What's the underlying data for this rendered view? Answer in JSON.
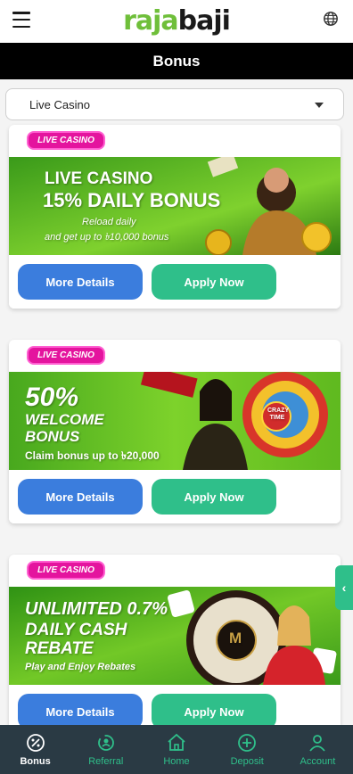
{
  "header": {
    "logo_part1": "raja",
    "logo_part2": "baji"
  },
  "titlebar": {
    "title": "Bonus"
  },
  "filter": {
    "selected": "Live Casino"
  },
  "cards": [
    {
      "tag": "LIVE CASINO",
      "line1": "LIVE CASINO",
      "line2": "15% DAILY BONUS",
      "line3": "Reload daily",
      "line4": "and get up to ৳10,000 bonus",
      "more_label": "More Details",
      "apply_label": "Apply Now"
    },
    {
      "tag": "LIVE CASINO",
      "line1": "50%",
      "line2": "WELCOME",
      "line3": "BONUS",
      "line4": "Claim bonus up to ৳20,000",
      "wheel_label": "CRAZY TIME",
      "more_label": "More Details",
      "apply_label": "Apply Now"
    },
    {
      "tag": "LIVE CASINO",
      "line1": "UNLIMITED 0.7%",
      "line2": "DAILY CASH",
      "line3": "REBATE",
      "line4": "Play and Enjoy Rebates",
      "wheel_label": "M",
      "more_label": "More Details",
      "apply_label": "Apply Now"
    }
  ],
  "nav": [
    {
      "label": "Bonus",
      "icon": "bonus-percent-icon"
    },
    {
      "label": "Referral",
      "icon": "referral-icon"
    },
    {
      "label": "Home",
      "icon": "home-icon"
    },
    {
      "label": "Deposit",
      "icon": "deposit-plus-icon"
    },
    {
      "label": "Account",
      "icon": "account-icon"
    }
  ],
  "colors": {
    "accent": "#2fbf8a",
    "primary_button": "#3b7ddd",
    "tag": "#e4149e",
    "nav_bg": "#2a3a44"
  }
}
